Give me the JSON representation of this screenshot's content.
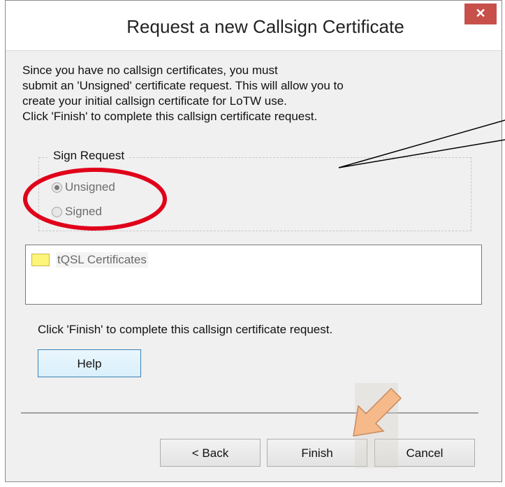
{
  "dialog": {
    "title": "Request a new Callsign Certificate",
    "close_symbol": "✕"
  },
  "description": {
    "line1": "Since you have no callsign certificates, you must",
    "line2": "submit an 'Unsigned' certificate request. This will allow you to",
    "line3": "create your initial callsign certificate for LoTW use.",
    "line4": "Click 'Finish' to complete this callsign certificate request."
  },
  "sign_request": {
    "label": "Sign Request",
    "options": [
      {
        "label": "Unsigned",
        "selected": true,
        "enabled": false
      },
      {
        "label": "Signed",
        "selected": false,
        "enabled": false
      }
    ]
  },
  "tree": {
    "items": [
      {
        "label": "tQSL Certificates",
        "icon": "folder-icon"
      }
    ]
  },
  "hint": "Click 'Finish' to complete this callsign certificate request.",
  "buttons": {
    "help": "Help",
    "back": "< Back",
    "finish": "Finish",
    "cancel": "Cancel"
  },
  "colors": {
    "close_button": "#c7504b",
    "annotation_circle": "#e0001a",
    "arrow": "#f5b98a"
  }
}
